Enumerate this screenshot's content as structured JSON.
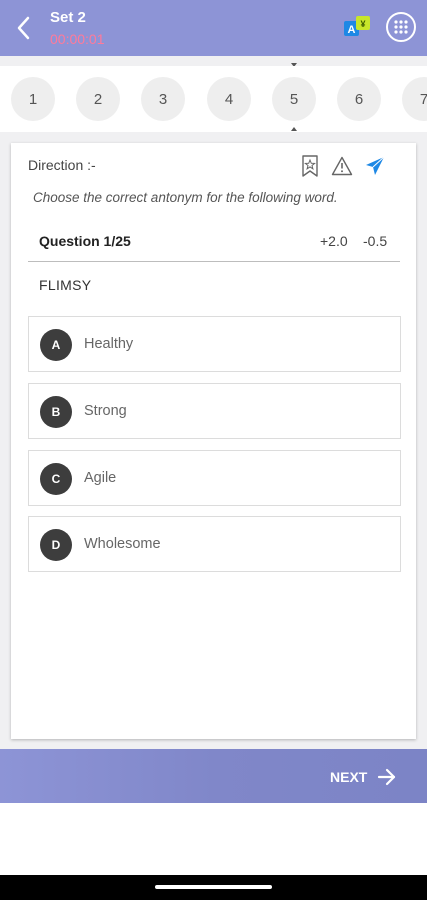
{
  "header": {
    "title": "Set 2",
    "timer": "00:00:01"
  },
  "question_numbers": [
    "1",
    "2",
    "3",
    "4",
    "5",
    "6",
    "7"
  ],
  "current_question_number": "5",
  "card": {
    "direction_label": "Direction :-",
    "direction_text": "Choose the correct antonym for the following word.",
    "question_label": "Question 1/25",
    "positive_marks": "+2.0",
    "negative_marks": "-0.5",
    "word": "FLIMSY",
    "options": [
      {
        "letter": "A",
        "text": "Healthy"
      },
      {
        "letter": "B",
        "text": "Strong"
      },
      {
        "letter": "C",
        "text": "Agile"
      },
      {
        "letter": "D",
        "text": "Wholesome"
      }
    ]
  },
  "footer": {
    "next_label": "NEXT"
  },
  "colors": {
    "header_bg": "#8d94d6",
    "timer": "#ff7a9a",
    "option_badge": "#3d3d3d",
    "send_icon": "#1e88e5"
  },
  "icons": [
    "back-arrow-icon",
    "translate-icon",
    "grid-menu-icon",
    "bookmark-star-icon",
    "warning-icon",
    "send-icon",
    "arrow-right-icon"
  ]
}
